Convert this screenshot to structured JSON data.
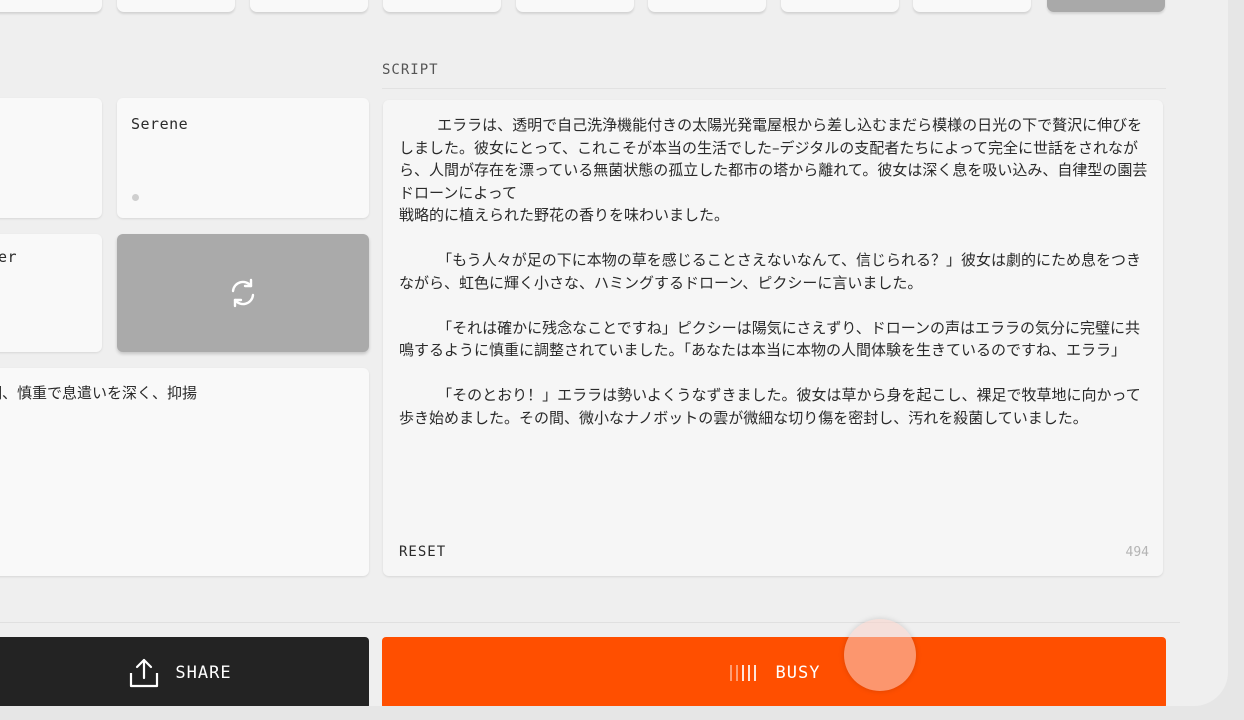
{
  "voices": {
    "serene_label": "Serene",
    "partial_label": "er"
  },
  "style_prompt": {
    "text": "口調、慎重で息遣いを深く、抑揚"
  },
  "script": {
    "section_label": "SCRIPT",
    "text": "        エララは、透明で自己洗浄機能付きの太陽光発電屋根から差し込むまだら模様の日光の下で贅沢に伸びをしました。彼女にとって、これこそが本当の生活でした–デジタルの支配者たちによって完全に世話をされながら、人間が存在を漂っている無菌状態の孤立した都市の塔から離れて。彼女は深く息を吸い込み、自律型の園芸ドローンによって\n戦略的に植えられた野花の香りを味わいました。\n\n        「もう人々が足の下に本物の草を感じることさえないなんて、信じられる？」彼女は劇的にため息をつきながら、虹色に輝く小さな、ハミングするドローン、ピクシーに言いました。\n\n        「それは確かに残念なことですね」ピクシーは陽気にさえずり、ドローンの声はエララの気分に完璧に共鳴するように慎重に調整されていました。「あなたは本当に本物の人間体験を生きているのですね、エララ」\n\n        「そのとおり！」エララは勢いよくうなずきました。彼女は草から身を起こし、裸足で牧草地に向かって歩き始めました。その間、微小なナノボットの雲が微細な切り傷を密封し、汚れを殺菌していました。",
    "reset_label": "RESET",
    "char_count": "494"
  },
  "actions": {
    "share_label": "SHARE",
    "busy_label": "BUSY"
  },
  "icons": {
    "refresh": "refresh-icon",
    "share": "share-icon",
    "progress": "progress-bars-icon"
  },
  "colors": {
    "accent": "#ff4f00",
    "dark_button": "#232323",
    "selected_card": "#aaaaaa"
  }
}
